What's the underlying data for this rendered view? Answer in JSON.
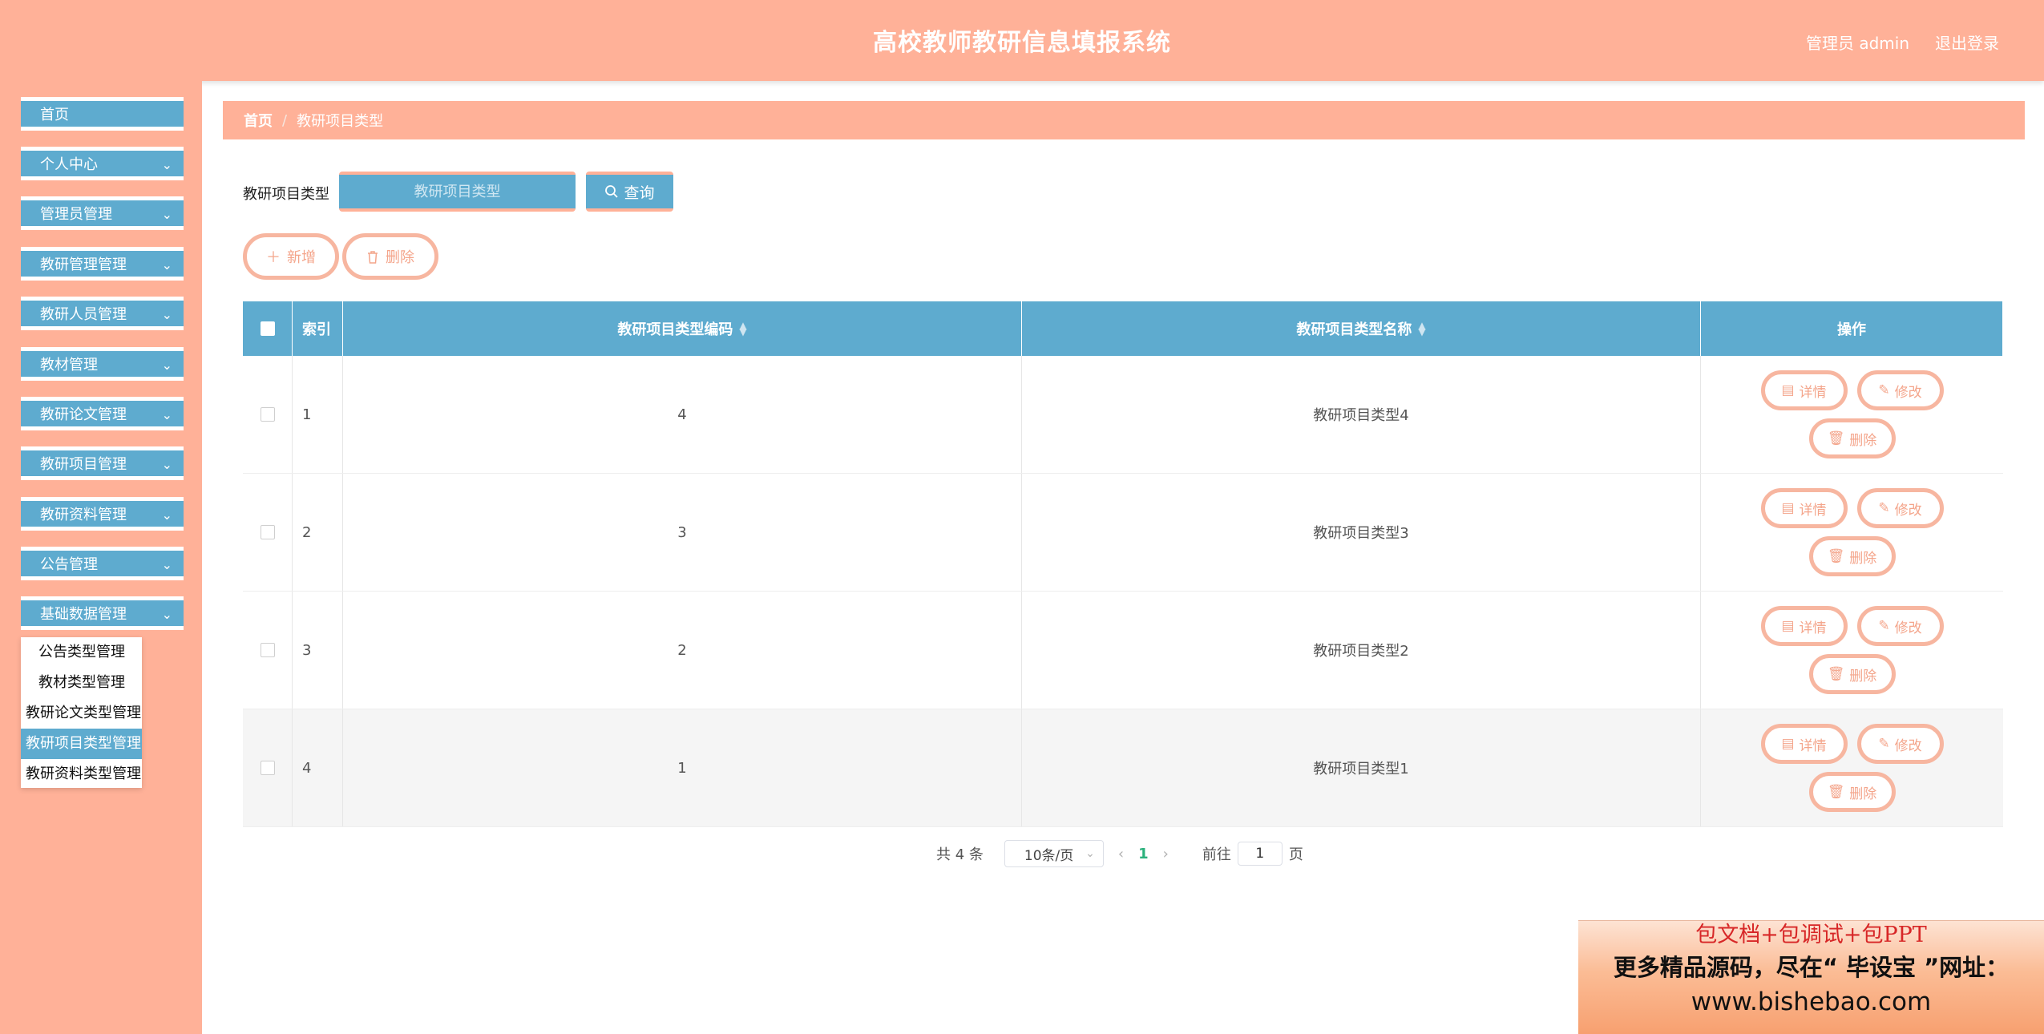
{
  "header": {
    "title": "高校教师教研信息填报系统",
    "user": "管理员 admin",
    "logout": "退出登录"
  },
  "sidebar": {
    "items": [
      {
        "label": "首页",
        "has_children": false
      },
      {
        "label": "个人中心",
        "has_children": true
      },
      {
        "label": "管理员管理",
        "has_children": true
      },
      {
        "label": "教研管理管理",
        "has_children": true
      },
      {
        "label": "教研人员管理",
        "has_children": true
      },
      {
        "label": "教材管理",
        "has_children": true
      },
      {
        "label": "教研论文管理",
        "has_children": true
      },
      {
        "label": "教研项目管理",
        "has_children": true
      },
      {
        "label": "教研资料管理",
        "has_children": true
      },
      {
        "label": "公告管理",
        "has_children": true
      },
      {
        "label": "基础数据管理",
        "has_children": true
      }
    ],
    "submenu": [
      {
        "label": "公告类型管理",
        "active": false
      },
      {
        "label": "教材类型管理",
        "active": false
      },
      {
        "label": "教研论文类型管理",
        "active": false
      },
      {
        "label": "教研项目类型管理",
        "active": true
      },
      {
        "label": "教研资料类型管理",
        "active": false
      }
    ]
  },
  "breadcrumb": {
    "home": "首页",
    "separator": "/",
    "current": "教研项目类型"
  },
  "search": {
    "label": "教研项目类型",
    "placeholder": "教研项目类型",
    "button": "查询"
  },
  "actions": {
    "add": "新增",
    "delete": "删除"
  },
  "table": {
    "headers": {
      "index": "索引",
      "code": "教研项目类型编码",
      "name": "教研项目类型名称",
      "ops": "操作"
    },
    "rows": [
      {
        "index": "1",
        "code": "4",
        "name": "教研项目类型4"
      },
      {
        "index": "2",
        "code": "3",
        "name": "教研项目类型3"
      },
      {
        "index": "3",
        "code": "2",
        "name": "教研项目类型2"
      },
      {
        "index": "4",
        "code": "1",
        "name": "教研项目类型1"
      }
    ],
    "row_actions": {
      "detail": "详情",
      "edit": "修改",
      "delete": "删除"
    }
  },
  "pagination": {
    "total": "共 4 条",
    "page_size": "10条/页",
    "current_page": "1",
    "goto_label": "前往",
    "goto_value": "1",
    "page_suffix": "页"
  },
  "promo": {
    "line1": "包文档+包调试+包PPT",
    "line2": "更多精品源码，尽在“ 毕设宝 ”网址：",
    "line3": "www.bishebao.com"
  },
  "colors": {
    "header": "#ffb198",
    "menu": "#5eabcf",
    "accent_border": "#f7b6a0",
    "page_active": "#2bb17c"
  }
}
